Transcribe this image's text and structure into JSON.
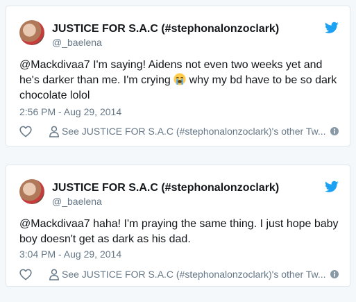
{
  "tweets": [
    {
      "display_name": "JUSTICE FOR S.A.C (#stephonalonzoclark)",
      "handle": "@_baelena",
      "text_before_emoji": "@Mackdivaa7 I'm saying! Aidens not even two weeks yet and he's darker than me. I'm crying ",
      "emoji": "loudly-crying-face-emoji",
      "text_after_emoji": " why my bd have to be so dark chocolate lolol",
      "timestamp": "2:56 PM - Aug 29, 2014",
      "see_profile_label": "See JUSTICE FOR S.A.C (#stephonalonzoclark)'s other Tw..."
    },
    {
      "display_name": "JUSTICE FOR S.A.C (#stephonalonzoclark)",
      "handle": "@_baelena",
      "text": "@Mackdivaa7 haha! I'm praying the same thing. I just hope baby boy doesn't get as dark as his dad.",
      "timestamp": "3:04 PM - Aug 29, 2014",
      "see_profile_label": "See JUSTICE FOR S.A.C (#stephonalonzoclark)'s other Tw..."
    }
  ],
  "icons": {
    "brand": "twitter-bird-icon",
    "like": "heart-icon",
    "profile": "person-icon",
    "info": "info-icon"
  },
  "colors": {
    "twitter_blue": "#1da1f2",
    "text_primary": "#14171a",
    "text_secondary": "#657786",
    "border": "#e1e8ed",
    "background": "#f5f8fa"
  }
}
